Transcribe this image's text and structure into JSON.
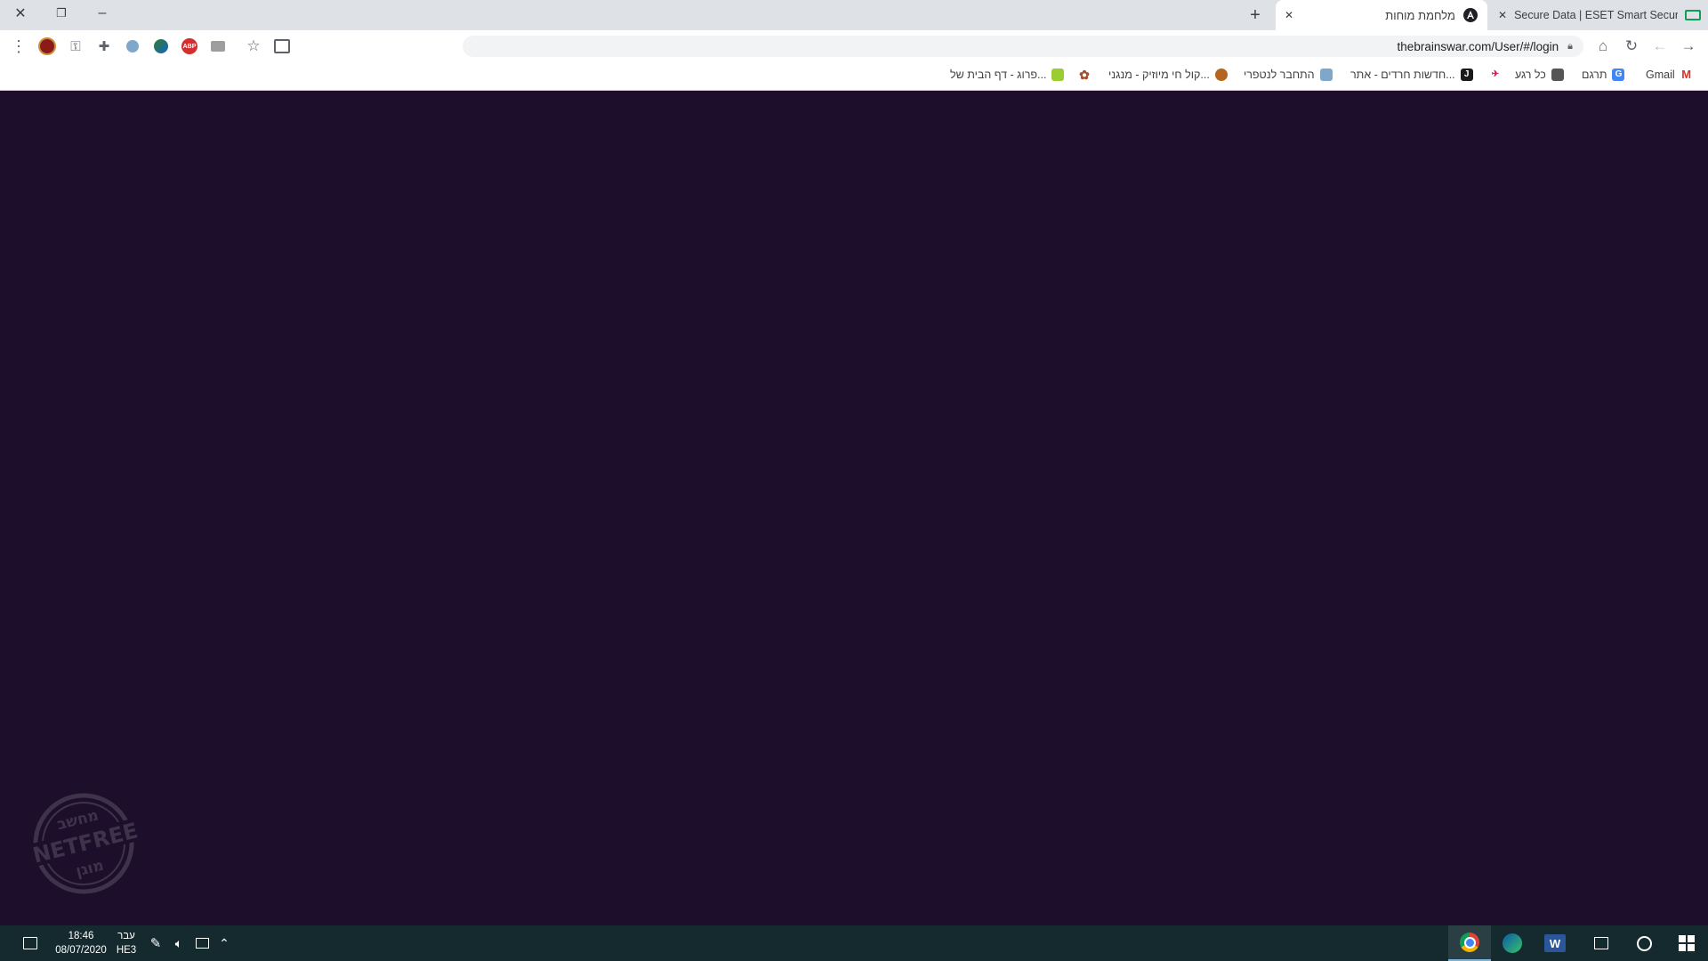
{
  "browser": {
    "tabs": [
      {
        "title": "Secure Data | ESET Smart Securit",
        "close_icon": "✕"
      },
      {
        "title": "מלחמת מוחות",
        "close_icon": "✕"
      }
    ],
    "new_tab_icon": "+",
    "window_controls": {
      "minimize": "–",
      "restore": "❐",
      "close": "✕"
    },
    "url": "thebrainswar.com/User/#/login",
    "bookmarks": [
      {
        "label": "Gmail",
        "icon": "gmail-icon",
        "color": "#d93025"
      },
      {
        "label": "תרגם",
        "icon": "translate-icon",
        "color": "#4285f4"
      },
      {
        "label": "כל רגע",
        "icon": "news-icon",
        "color": "#555555"
      },
      {
        "label": "",
        "icon": "bookmark-logo-icon",
        "color": "#c2185b"
      },
      {
        "label": "חדשות חרדים - אתר...",
        "icon": "jdn-icon",
        "color": "#1a1a1a"
      },
      {
        "label": "התחבר לנטפרי",
        "icon": "netfree-icon",
        "color": "#7fa7c9"
      },
      {
        "label": "קול חי מיוזיק - מנגני...",
        "icon": "music-icon",
        "color": "#b5651d"
      },
      {
        "label": "",
        "icon": "flower-icon",
        "color": "#a0522d"
      },
      {
        "label": "פרוג - דף הבית של...",
        "icon": "prog-icon",
        "color": "#9acd32"
      }
    ]
  },
  "taskbar": {
    "time": "18:46",
    "date": "08/07/2020",
    "lang_top": "עבר",
    "lang_bottom": "HE3"
  },
  "watermark": {
    "top": "מחשב",
    "middle": "NETFREE",
    "bottom": "מוגן"
  },
  "colors": {
    "page_background": "#1d0e2c",
    "taskbar": "#142a2e",
    "tab_strip": "#dee1e6"
  }
}
